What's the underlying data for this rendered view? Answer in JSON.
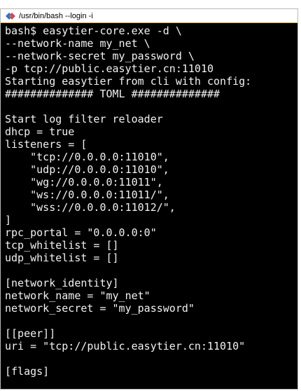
{
  "window": {
    "title": "/usr/bin/bash --login -i",
    "icon": "bash-app-icon"
  },
  "terminal": {
    "lines": [
      "bash$ easytier-core.exe -d \\",
      "--network-name my_net \\",
      "--network-secret my_password \\",
      "-p tcp://public.easytier.cn:11010",
      "Starting easytier from cli with config:",
      "############## TOML ##############",
      "",
      "Start log filter reloader",
      "dhcp = true",
      "listeners = [",
      "    \"tcp://0.0.0.0:11010\",",
      "    \"udp://0.0.0.0:11010\",",
      "    \"wg://0.0.0.0:11011\",",
      "    \"ws://0.0.0.0:11011/\",",
      "    \"wss://0.0.0.0:11012/\",",
      "]",
      "rpc_portal = \"0.0.0.0:0\"",
      "tcp_whitelist = []",
      "udp_whitelist = []",
      "",
      "[network_identity]",
      "network_name = \"my_net\"",
      "network_secret = \"my_password\"",
      "",
      "[[peer]]",
      "uri = \"tcp://public.easytier.cn:11010\"",
      "",
      "[flags]"
    ]
  }
}
